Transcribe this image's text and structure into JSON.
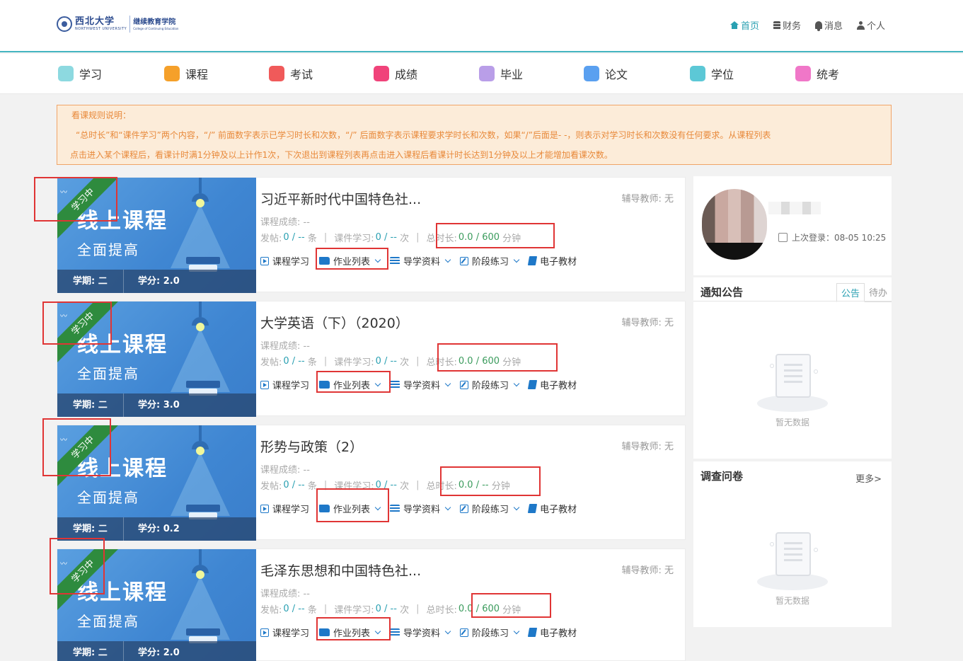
{
  "header": {
    "logo": {
      "university_cn": "西北大学",
      "university_en": "NORTHWEST UNIVERSITY",
      "college_cn": "继续教育学院",
      "college_en": "College of Continuing Education"
    },
    "nav": [
      {
        "label": "首页",
        "icon": "home-icon",
        "active": true
      },
      {
        "label": "财务",
        "icon": "database-icon",
        "active": false
      },
      {
        "label": "消息",
        "icon": "bell-icon",
        "active": false
      },
      {
        "label": "个人",
        "icon": "user-icon",
        "active": false
      }
    ],
    "accent_color": "#2aa0b2"
  },
  "main_nav": [
    {
      "label": "学习",
      "icon": "study-icon",
      "color": "#8dd9e0"
    },
    {
      "label": "课程",
      "icon": "bookmark-icon",
      "color": "#f5a02a"
    },
    {
      "label": "考试",
      "icon": "exam-icon",
      "color": "#f05a5a"
    },
    {
      "label": "成绩",
      "icon": "score-100-icon",
      "color": "#f0437a"
    },
    {
      "label": "毕业",
      "icon": "graduate-icon",
      "color": "#b99ee8"
    },
    {
      "label": "论文",
      "icon": "document-icon",
      "color": "#5aa0f0"
    },
    {
      "label": "学位",
      "icon": "cap-icon",
      "color": "#5cc8d6"
    },
    {
      "label": "统考",
      "icon": "folder-icon",
      "color": "#f077c8"
    }
  ],
  "rules": {
    "title": "看课规则说明：",
    "line1": "“总时长”和“课件学习”两个内容，“/” 前面数字表示已学习时长和次数，“/” 后面数字表示课程要求学时长和次数，如果“/”后面是- -，则表示对学习时长和次数没有任何要求。从课程列表",
    "line2": "点击进入某个课程后，看课计时满1分钟及以上计作1次，下次退出到课程列表再点击进入课程后看课计时长达到1分钟及以上才能增加看课次数。"
  },
  "course_banner": {
    "status": "学习中",
    "headline": "线上课程",
    "subline": "全面提高",
    "term_label": "学期: 二"
  },
  "labels": {
    "tutor": "辅导教师: 无",
    "score": "课程成绩: --",
    "posts": "发帖:",
    "posts_val": "0 / --",
    "posts_unit": "条",
    "courseware": "课件学习:",
    "courseware_val": "0 / --",
    "courseware_unit": "次",
    "duration": "总时长:",
    "duration_unit": "分钟"
  },
  "actions": [
    {
      "label": "课程学习",
      "icon": "play-icon",
      "dropdown": false
    },
    {
      "label": "作业列表",
      "icon": "folder-icon",
      "dropdown": true
    },
    {
      "label": "导学资料",
      "icon": "list-icon",
      "dropdown": true
    },
    {
      "label": "阶段练习",
      "icon": "edit-icon",
      "dropdown": true
    },
    {
      "label": "电子教材",
      "icon": "book-icon",
      "dropdown": false
    }
  ],
  "courses": [
    {
      "title": "习近平新时代中国特色社...",
      "credit": "学分: 2.0",
      "duration_val": "0.0 / 600"
    },
    {
      "title": "大学英语（下）（2020）",
      "credit": "学分: 3.0",
      "duration_val": "0.0 / 600"
    },
    {
      "title": "形势与政策（2）",
      "credit": "学分: 0.2",
      "duration_val": "0.0 / --"
    },
    {
      "title": "毛泽东思想和中国特色社...",
      "credit": "学分: 2.0",
      "duration_val": "0.0 / 600"
    }
  ],
  "profile": {
    "last_login": "上次登录：08-05 10:25"
  },
  "notice": {
    "title": "通知公告",
    "tabs": [
      "公告",
      "待办"
    ],
    "empty": "暂无数据"
  },
  "survey": {
    "title": "调查问卷",
    "more": "更多>",
    "empty": "暂无数据"
  }
}
